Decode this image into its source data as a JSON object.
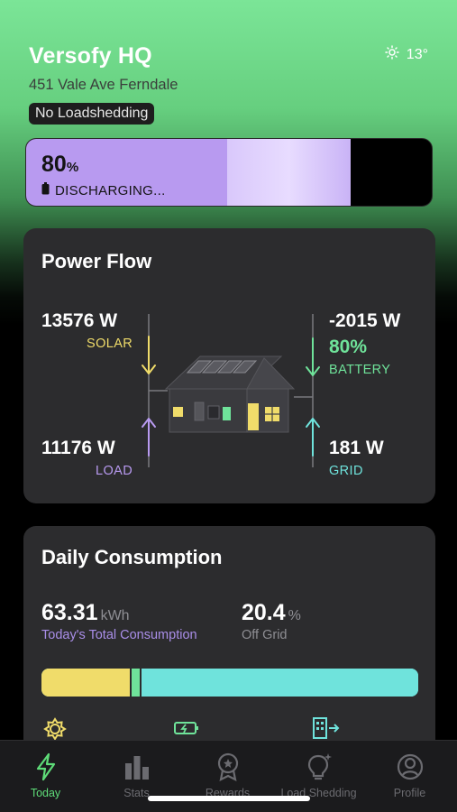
{
  "site": {
    "name": "Versofy HQ",
    "address": "451 Vale Ave Ferndale",
    "loadshedding_status": "No Loadshedding"
  },
  "weather": {
    "icon": "sun-icon",
    "temperature": "13°"
  },
  "battery": {
    "percent": "80",
    "percent_unit": "%",
    "status": "DISCHARGING...",
    "fill_fraction": 0.8,
    "fill_color": "#b89af0"
  },
  "power_flow": {
    "title": "Power Flow",
    "solar": {
      "value": "13576 W",
      "label": "SOLAR",
      "color": "#f0dc6a"
    },
    "battery": {
      "value": "-2015 W",
      "percent": "80%",
      "label": "BATTERY",
      "color": "#6fe39a"
    },
    "load": {
      "value": "11176 W",
      "label": "LOAD",
      "color": "#b89af0"
    },
    "grid": {
      "value": "181 W",
      "label": "GRID",
      "color": "#6fe3dc"
    }
  },
  "daily_consumption": {
    "title": "Daily Consumption",
    "total": {
      "value": "63.31",
      "unit": "kWh",
      "label": "Today's Total Consumption"
    },
    "off_grid": {
      "value": "20.4",
      "unit": "%",
      "label": "Off Grid"
    },
    "breakdown": [
      {
        "source": "solar",
        "fraction": 0.235,
        "color": "#f0dc6a",
        "icon": "sun-icon"
      },
      {
        "source": "battery",
        "fraction": 0.025,
        "color": "#6fe39a",
        "icon": "battery-charging-icon"
      },
      {
        "source": "grid",
        "fraction": 0.74,
        "color": "#6fe3dc",
        "icon": "building-import-icon"
      }
    ]
  },
  "tabbar": {
    "active": "today",
    "tabs": [
      {
        "id": "today",
        "label": "Today",
        "icon": "bolt-icon"
      },
      {
        "id": "stats",
        "label": "Stats",
        "icon": "bar-chart-icon"
      },
      {
        "id": "rewards",
        "label": "Rewards",
        "icon": "award-icon"
      },
      {
        "id": "load_shedding",
        "label": "Load Shedding",
        "icon": "lightbulb-icon"
      },
      {
        "id": "profile",
        "label": "Profile",
        "icon": "user-circle-icon"
      }
    ]
  }
}
